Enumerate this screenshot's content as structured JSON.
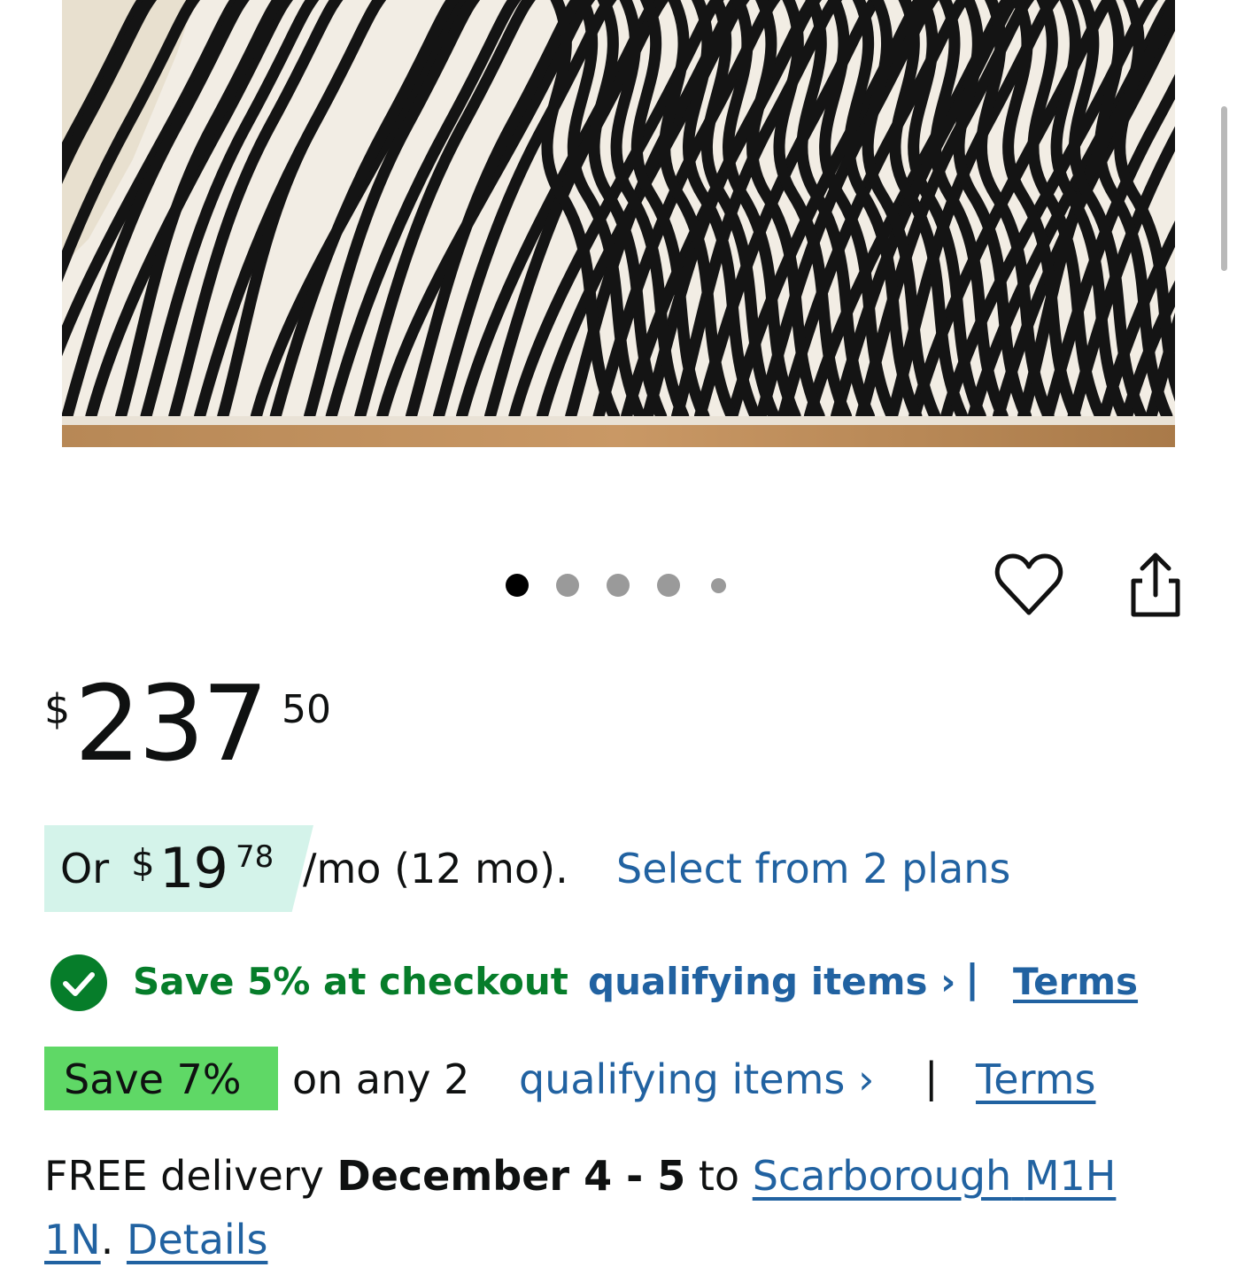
{
  "product": {
    "image_alt": "Black and cream zebra striped area rug",
    "carousel": {
      "count": 5,
      "active_index": 0
    }
  },
  "icons": {
    "favorite": "heart-outline-icon",
    "share": "share-icon",
    "checkout_saving": "checkmark-circle-icon"
  },
  "price": {
    "symbol": "$",
    "whole": "237",
    "fraction": "50"
  },
  "installment": {
    "prefix": "Or",
    "symbol": "$",
    "whole": "19",
    "cents": "78",
    "terms": "/mo (12 mo).",
    "link": "Select from 2 plans"
  },
  "checkout_saving": {
    "text": "Save 5% at checkout",
    "link": "qualifying items ›",
    "separator": "|",
    "terms": "Terms"
  },
  "multi_buy": {
    "badge": "Save 7%",
    "text": "on any 2",
    "link": "qualifying items ›",
    "separator": "|",
    "terms": "Terms"
  },
  "delivery": {
    "prefix": "FREE delivery",
    "dates": "December 4 - 5",
    "to": "to",
    "location_line1": "Scarborough",
    "location_line2": "M1H 1N",
    "period": ".",
    "details": "Details"
  },
  "colors": {
    "link": "#2162a1",
    "green_text": "#067d2a",
    "installment_badge": "#d4f3ea",
    "save_badge": "#5fd866",
    "text": "#0f1111"
  }
}
